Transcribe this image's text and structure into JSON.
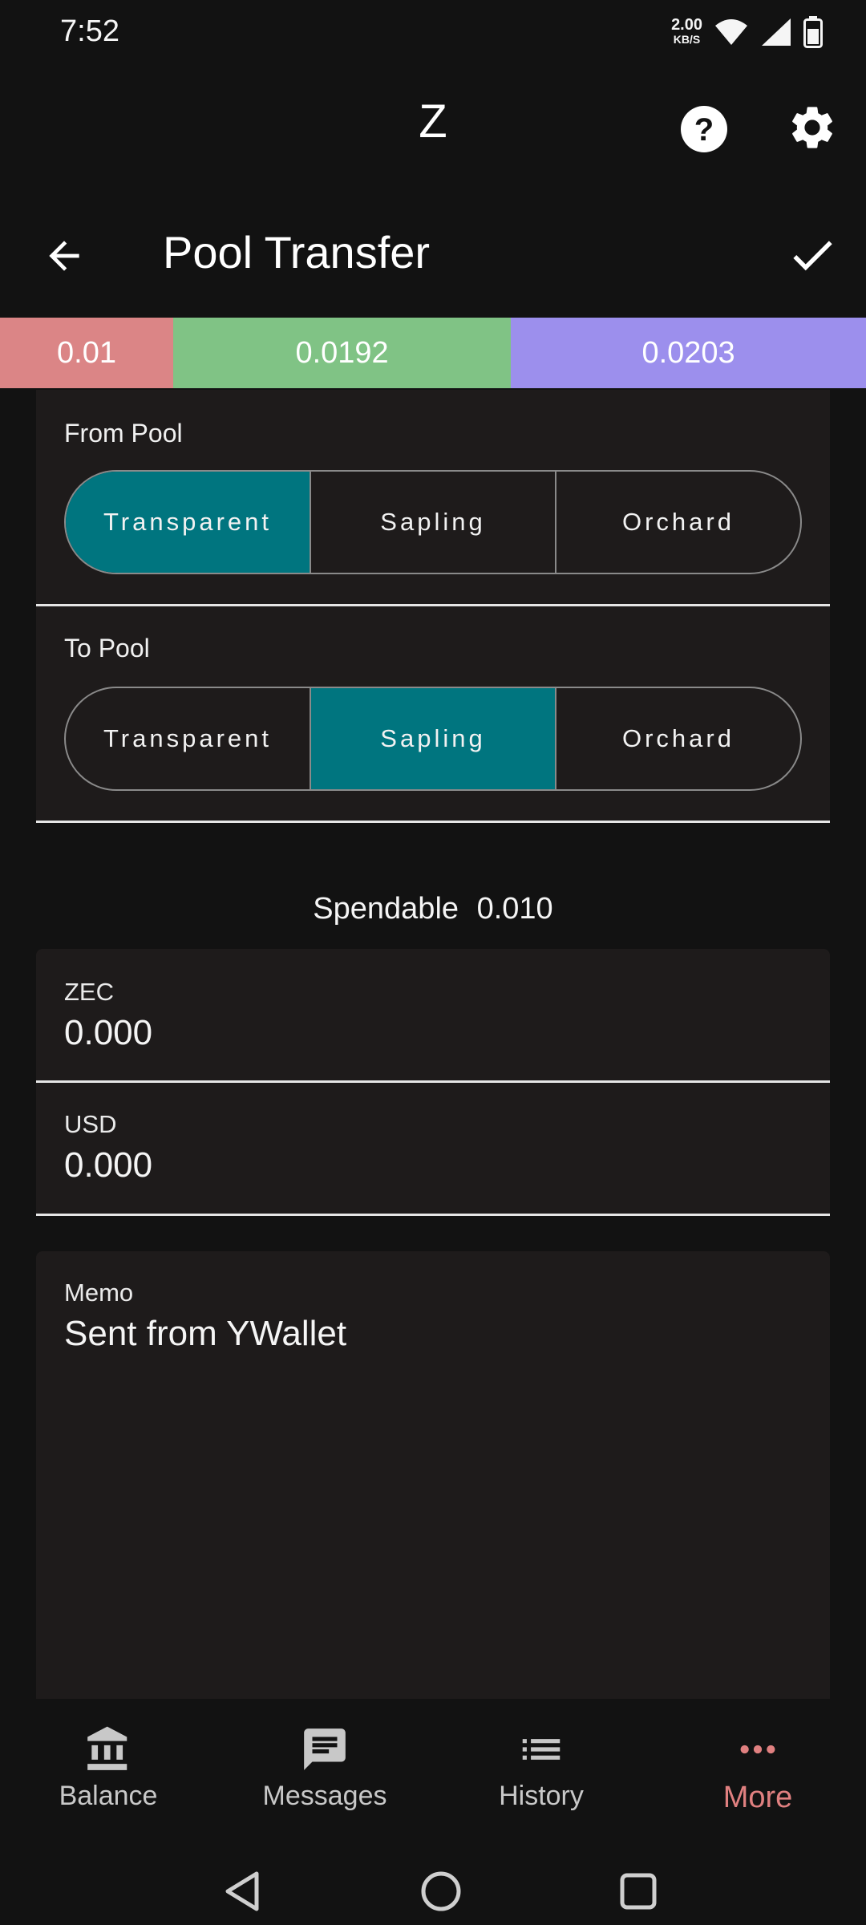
{
  "status_bar": {
    "time": "7:52",
    "net_speed_value": "2.00",
    "net_speed_unit": "KB/S",
    "icons": [
      "wifi-icon",
      "signal-icon",
      "battery-icon"
    ]
  },
  "app_bar": {
    "logo_text": "Z",
    "icons": [
      "help-icon",
      "settings-icon"
    ]
  },
  "header": {
    "title": "Pool Transfer",
    "back_icon": "arrow-back-icon",
    "confirm_icon": "check-icon"
  },
  "pool_balances": [
    {
      "value": "0.01",
      "color": "#db8586",
      "fraction": 0.2
    },
    {
      "value": "0.0192",
      "color": "#80c385",
      "fraction": 0.39
    },
    {
      "value": "0.0203",
      "color": "#9c8fed",
      "fraction": 0.41
    }
  ],
  "from_pool": {
    "label": "From Pool",
    "options": [
      "Transparent",
      "Sapling",
      "Orchard"
    ],
    "selected": "Transparent"
  },
  "to_pool": {
    "label": "To Pool",
    "options": [
      "Transparent",
      "Sapling",
      "Orchard"
    ],
    "selected": "Sapling"
  },
  "spendable": {
    "label": "Spendable",
    "value": "0.010"
  },
  "amount": {
    "zec_label": "ZEC",
    "zec_value": "0.000",
    "usd_label": "USD",
    "usd_value": "0.000"
  },
  "memo": {
    "label": "Memo",
    "value": "Sent from YWallet"
  },
  "bottom_nav": {
    "items": [
      {
        "label": "Balance",
        "icon": "bank-icon"
      },
      {
        "label": "Messages",
        "icon": "message-icon"
      },
      {
        "label": "History",
        "icon": "list-icon"
      },
      {
        "label": "More",
        "icon": "more-dots-icon"
      }
    ],
    "active": "More",
    "active_color": "#e08080"
  },
  "accent": {
    "segment_selected": "#00757f"
  }
}
